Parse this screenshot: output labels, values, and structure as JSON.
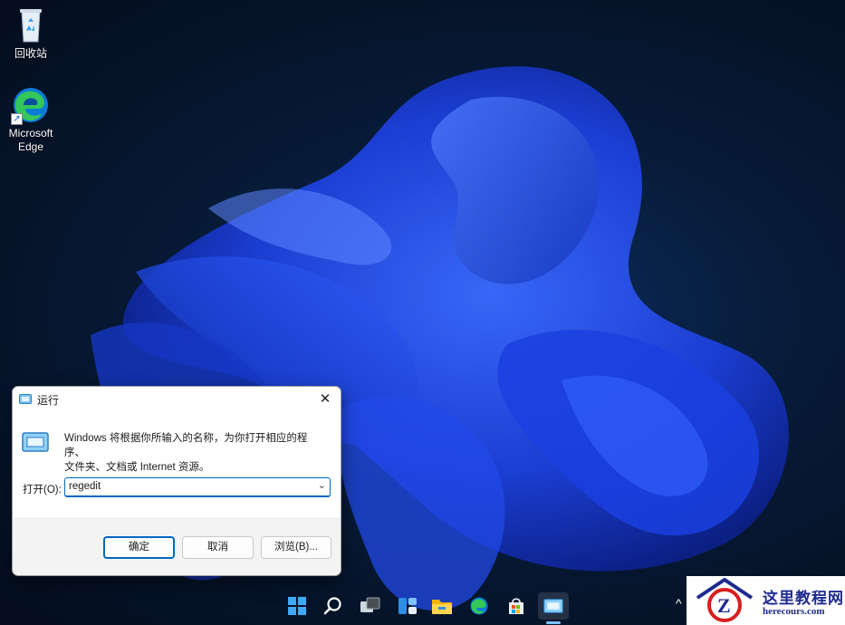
{
  "desktop": {
    "icons": [
      {
        "label": "回收站",
        "icon": "recycle-bin-icon"
      },
      {
        "label": "Microsoft\nEdge",
        "label_line1": "Microsoft",
        "label_line2": "Edge",
        "icon": "edge-icon"
      }
    ]
  },
  "run_dialog": {
    "title": "运行",
    "description_line1": "Windows 将根据你所输入的名称，为你打开相应的程序、",
    "description_line2": "文件夹、文档或 Internet 资源。",
    "open_label": "打开(O):",
    "input_value": "regedit",
    "buttons": {
      "ok": "确定",
      "cancel": "取消",
      "browse": "浏览(B)..."
    },
    "close_glyph": "✕"
  },
  "taskbar": {
    "items": [
      "start-icon",
      "search-icon",
      "task-view-icon",
      "widgets-icon",
      "file-explorer-icon",
      "edge-icon",
      "store-icon",
      "run-icon"
    ],
    "tray_arrow": "^"
  },
  "watermark": {
    "line1": "这里教程网",
    "line2": "herecours.com"
  },
  "colors": {
    "accent": "#0067c0",
    "wallpaper_dark": "#040d1d",
    "bloom_blue": "#1f4bff"
  }
}
